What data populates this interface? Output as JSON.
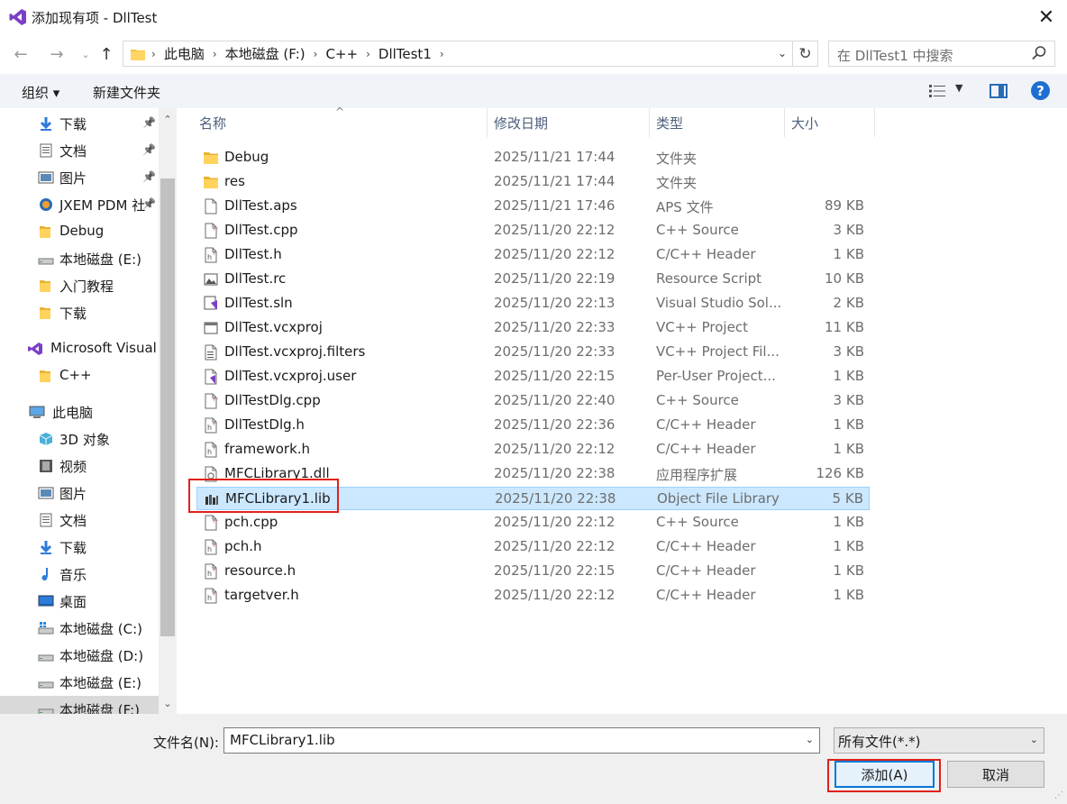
{
  "window": {
    "title": "添加现有项 - DllTest",
    "close_glyph": "✕"
  },
  "address": {
    "crumbs": [
      "此电脑",
      "本地磁盘 (F:)",
      "C++",
      "DllTest1"
    ],
    "search_placeholder": "在 DllTest1 中搜索"
  },
  "toolbar": {
    "organize_label": "组织 ▾",
    "new_folder_label": "新建文件夹",
    "help_label": "?"
  },
  "nav": {
    "items": [
      {
        "label": "下载",
        "icon": "download-arrow-icon",
        "pinned": true
      },
      {
        "label": "文档",
        "icon": "document-icon",
        "pinned": true
      },
      {
        "label": "图片",
        "icon": "pictures-icon",
        "pinned": true
      },
      {
        "label": "JXEM PDM 社",
        "icon": "jxem-icon",
        "pinned": true
      },
      {
        "label": "Debug",
        "icon": "folder-icon",
        "pinned": false
      },
      {
        "label": "本地磁盘 (E:)",
        "icon": "drive-icon",
        "pinned": false
      },
      {
        "label": "入门教程",
        "icon": "folder-icon",
        "pinned": false
      },
      {
        "label": "下载",
        "icon": "folder-icon",
        "pinned": false
      },
      {
        "label": "Microsoft Visual",
        "icon": "visual-studio-icon",
        "pinned": false
      },
      {
        "label": "C++",
        "icon": "folder-icon",
        "pinned": false
      },
      {
        "label": "此电脑",
        "icon": "computer-icon",
        "pinned": false
      },
      {
        "label": "3D 对象",
        "icon": "3d-objects-icon",
        "pinned": false
      },
      {
        "label": "视频",
        "icon": "video-icon",
        "pinned": false
      },
      {
        "label": "图片",
        "icon": "pictures-icon",
        "pinned": false
      },
      {
        "label": "文档",
        "icon": "document-icon",
        "pinned": false
      },
      {
        "label": "下载",
        "icon": "download-arrow-icon",
        "pinned": false
      },
      {
        "label": "音乐",
        "icon": "music-icon",
        "pinned": false
      },
      {
        "label": "桌面",
        "icon": "desktop-icon",
        "pinned": false
      },
      {
        "label": "本地磁盘 (C:)",
        "icon": "windows-drive-icon",
        "pinned": false
      },
      {
        "label": "本地磁盘 (D:)",
        "icon": "drive-icon",
        "pinned": false
      },
      {
        "label": "本地磁盘 (E:)",
        "icon": "drive-icon",
        "pinned": false
      },
      {
        "label": "本地磁盘 (F:)",
        "icon": "drive-icon",
        "pinned": false
      }
    ]
  },
  "columns": {
    "name": "名称",
    "date": "修改日期",
    "type": "类型",
    "size": "大小"
  },
  "files": [
    {
      "name": "Debug",
      "date": "2025/11/21 17:44",
      "type": "文件夹",
      "size": "",
      "icon": "folder-icon"
    },
    {
      "name": "res",
      "date": "2025/11/21 17:44",
      "type": "文件夹",
      "size": "",
      "icon": "folder-icon"
    },
    {
      "name": "DllTest.aps",
      "date": "2025/11/21 17:46",
      "type": "APS 文件",
      "size": "89 KB",
      "icon": "file-icon"
    },
    {
      "name": "DllTest.cpp",
      "date": "2025/11/20 22:12",
      "type": "C++ Source",
      "size": "3 KB",
      "icon": "cpp-file-icon"
    },
    {
      "name": "DllTest.h",
      "date": "2025/11/20 22:12",
      "type": "C/C++ Header",
      "size": "1 KB",
      "icon": "header-file-icon"
    },
    {
      "name": "DllTest.rc",
      "date": "2025/11/20 22:19",
      "type": "Resource Script",
      "size": "10 KB",
      "icon": "resource-file-icon"
    },
    {
      "name": "DllTest.sln",
      "date": "2025/11/20 22:13",
      "type": "Visual Studio Sol...",
      "size": "2 KB",
      "icon": "solution-file-icon"
    },
    {
      "name": "DllTest.vcxproj",
      "date": "2025/11/20 22:33",
      "type": "VC++ Project",
      "size": "11 KB",
      "icon": "project-file-icon"
    },
    {
      "name": "DllTest.vcxproj.filters",
      "date": "2025/11/20 22:33",
      "type": "VC++ Project Fil...",
      "size": "3 KB",
      "icon": "filters-file-icon"
    },
    {
      "name": "DllTest.vcxproj.user",
      "date": "2025/11/20 22:15",
      "type": "Per-User Project...",
      "size": "1 KB",
      "icon": "user-file-icon"
    },
    {
      "name": "DllTestDlg.cpp",
      "date": "2025/11/20 22:40",
      "type": "C++ Source",
      "size": "3 KB",
      "icon": "cpp-file-icon"
    },
    {
      "name": "DllTestDlg.h",
      "date": "2025/11/20 22:36",
      "type": "C/C++ Header",
      "size": "1 KB",
      "icon": "header-file-icon"
    },
    {
      "name": "framework.h",
      "date": "2025/11/20 22:12",
      "type": "C/C++ Header",
      "size": "1 KB",
      "icon": "header-file-icon"
    },
    {
      "name": "MFCLibrary1.dll",
      "date": "2025/11/20 22:38",
      "type": "应用程序扩展",
      "size": "126 KB",
      "icon": "dll-file-icon"
    },
    {
      "name": "MFCLibrary1.lib",
      "date": "2025/11/20 22:38",
      "type": "Object File Library",
      "size": "5 KB",
      "icon": "lib-file-icon",
      "selected": true
    },
    {
      "name": "pch.cpp",
      "date": "2025/11/20 22:12",
      "type": "C++ Source",
      "size": "1 KB",
      "icon": "cpp-file-icon"
    },
    {
      "name": "pch.h",
      "date": "2025/11/20 22:12",
      "type": "C/C++ Header",
      "size": "1 KB",
      "icon": "header-file-icon"
    },
    {
      "name": "resource.h",
      "date": "2025/11/20 22:15",
      "type": "C/C++ Header",
      "size": "1 KB",
      "icon": "header-file-icon"
    },
    {
      "name": "targetver.h",
      "date": "2025/11/20 22:12",
      "type": "C/C++ Header",
      "size": "1 KB",
      "icon": "header-file-icon"
    }
  ],
  "bottom": {
    "filename_label": "文件名(N):",
    "filename_value": "MFCLibrary1.lib",
    "filter_value": "所有文件(*.*)",
    "add_label": "添加(A)",
    "cancel_label": "取消"
  },
  "colors": {
    "selection_bg": "#cce8ff",
    "highlight_red": "#e0201c",
    "accent_blue": "#0078d7"
  }
}
